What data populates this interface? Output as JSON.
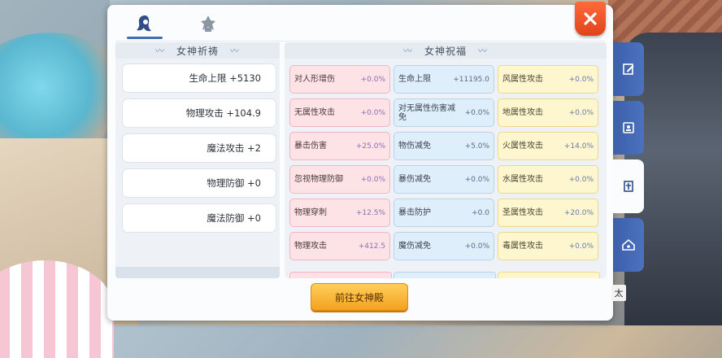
{
  "left": {
    "title": "女神祈祷",
    "items": [
      {
        "label": "生命上限 +5130"
      },
      {
        "label": "物理攻击 +104.9"
      },
      {
        "label": "魔法攻击 +2"
      },
      {
        "label": "物理防御 +0"
      },
      {
        "label": "魔法防御 +0"
      }
    ]
  },
  "right": {
    "title": "女神祝福",
    "cells": [
      {
        "name": "对人形增伤",
        "value": "+0.0%",
        "color": "pink"
      },
      {
        "name": "生命上限",
        "value": "+11195.0",
        "color": "blue"
      },
      {
        "name": "风属性攻击",
        "value": "+0.0%",
        "color": "yellow"
      },
      {
        "name": "无属性攻击",
        "value": "+0.0%",
        "color": "pink"
      },
      {
        "name": "对无属性伤害减免",
        "value": "+0.0%",
        "color": "blue"
      },
      {
        "name": "地属性攻击",
        "value": "+0.0%",
        "color": "yellow"
      },
      {
        "name": "暴击伤害",
        "value": "+25.0%",
        "color": "pink"
      },
      {
        "name": "物伤减免",
        "value": "+5.0%",
        "color": "blue"
      },
      {
        "name": "火属性攻击",
        "value": "+14.0%",
        "color": "yellow"
      },
      {
        "name": "忽视物理防御",
        "value": "+0.0%",
        "color": "pink"
      },
      {
        "name": "暴伤减免",
        "value": "+0.0%",
        "color": "blue"
      },
      {
        "name": "水属性攻击",
        "value": "+0.0%",
        "color": "yellow"
      },
      {
        "name": "物理穿刺",
        "value": "+12.5%",
        "color": "pink"
      },
      {
        "name": "暴击防护",
        "value": "+0.0",
        "color": "blue"
      },
      {
        "name": "圣属性攻击",
        "value": "+20.0%",
        "color": "yellow"
      },
      {
        "name": "物理攻击",
        "value": "+412.5",
        "color": "pink"
      },
      {
        "name": "魔伤减免",
        "value": "+0.0%",
        "color": "blue"
      },
      {
        "name": "毒属性攻击",
        "value": "+0.0%",
        "color": "yellow"
      }
    ]
  },
  "buttons": {
    "go_temple": "前往女神殿"
  },
  "side": {
    "label": "太"
  },
  "icons": {
    "tab1": "goddess-icon",
    "tab2": "emblem-icon",
    "close": "close-icon",
    "side": [
      "edit-icon",
      "card-icon",
      "book-icon",
      "home-icon"
    ]
  },
  "colors": {
    "accent": "#3f6fae",
    "close": "#e84a1f",
    "button": "#f3a21f"
  }
}
